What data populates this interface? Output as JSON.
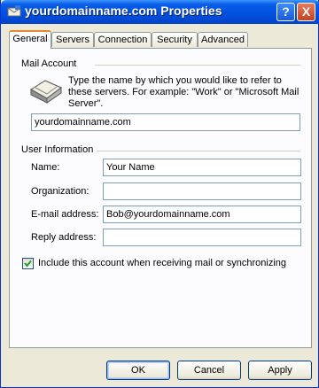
{
  "window": {
    "title": "yourdomainname.com Properties",
    "help_label": "?",
    "close_label": "X"
  },
  "tabs": [
    "General",
    "Servers",
    "Connection",
    "Security",
    "Advanced"
  ],
  "active_tab": "General",
  "mail_account": {
    "heading": "Mail Account",
    "description": "Type the name by which you would like to refer to these servers.  For example: \"Work\" or \"Microsoft Mail Server\".",
    "name_value": "yourdomainname.com"
  },
  "user_information": {
    "heading": "User Information",
    "fields": [
      {
        "label": "Name:",
        "value": "Your Name"
      },
      {
        "label": "Organization:",
        "value": ""
      },
      {
        "label": "E-mail address:",
        "value": "Bob@yourdomainname.com"
      },
      {
        "label": "Reply address:",
        "value": ""
      }
    ]
  },
  "include_account": {
    "label": "Include this account when receiving mail or synchronizing",
    "checked": true
  },
  "buttons": {
    "ok": "OK",
    "cancel": "Cancel",
    "apply": "Apply"
  },
  "colors": {
    "title_bar": "#0058e6",
    "dialog_bg": "#ece9d8",
    "input_border": "#7f9db9",
    "checkmark": "#21a121"
  }
}
